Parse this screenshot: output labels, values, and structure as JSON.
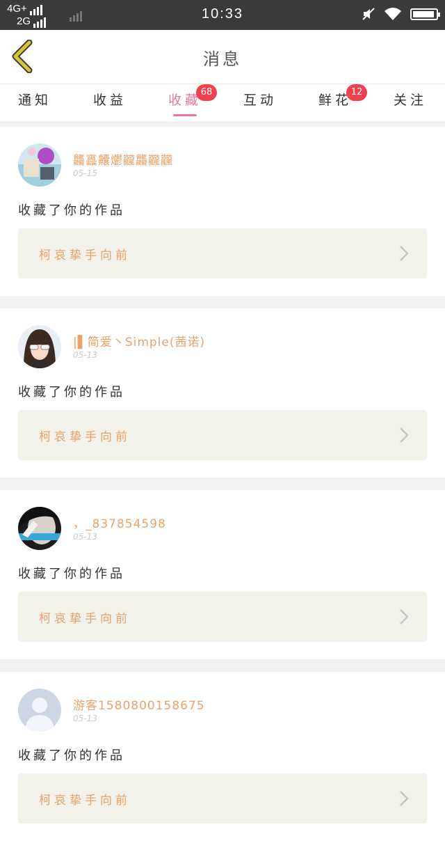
{
  "status_bar": {
    "network_top": "4G+",
    "network_bottom": "2G",
    "time": "10:33"
  },
  "header": {
    "title": "消息"
  },
  "tabs": [
    {
      "label": "通知"
    },
    {
      "label": "收益"
    },
    {
      "label": "收藏",
      "badge": "68",
      "active": true
    },
    {
      "label": "互动"
    },
    {
      "label": "鲜花",
      "badge": "12"
    },
    {
      "label": "关注"
    }
  ],
  "messages": [
    {
      "username": "龘靐齉爩龖龘龖龖",
      "date": "05-15",
      "action": "收藏了你的作品",
      "work_title": "柯哀挚手向前",
      "avatar": "avatar-1"
    },
    {
      "username": "|▌简爱丶Simple(茜诺)",
      "date": "05-13",
      "action": "收藏了你的作品",
      "work_title": "柯哀挚手向前",
      "avatar": "avatar-2"
    },
    {
      "username": "，_837854598",
      "date": "05-13",
      "action": "收藏了你的作品",
      "work_title": "柯哀挚手向前",
      "avatar": "avatar-3"
    },
    {
      "username": "游客1580800158675",
      "date": "05-13",
      "action": "收藏了你的作品",
      "work_title": "柯哀挚手向前",
      "avatar": "default-avatar"
    }
  ],
  "colors": {
    "accent": "#e6799f",
    "username": "#e8a26a",
    "badge": "#f0414e",
    "back_icon": "#c9b830"
  }
}
